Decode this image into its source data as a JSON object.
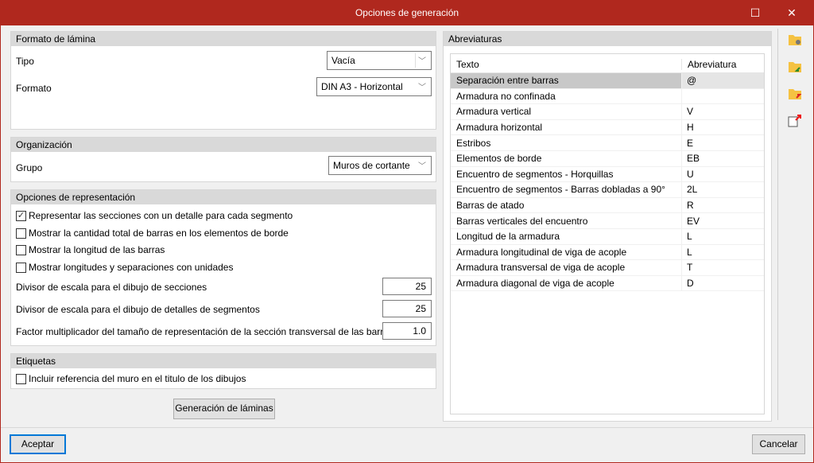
{
  "window": {
    "title": "Opciones de generación",
    "maximize_icon": "maximize-icon",
    "close_icon": "close-icon"
  },
  "formato": {
    "header": "Formato de lámina",
    "tipo_label": "Tipo",
    "tipo_value": "Vacía",
    "formato_label": "Formato",
    "formato_value": "DIN A3 - Horizontal"
  },
  "organizacion": {
    "header": "Organización",
    "grupo_label": "Grupo",
    "grupo_value": "Muros de cortante"
  },
  "representacion": {
    "header": "Opciones de representación",
    "checks": [
      {
        "label": "Representar las secciones con un detalle para cada segmento",
        "checked": true
      },
      {
        "label": "Mostrar la cantidad total de barras en los elementos de borde",
        "checked": false
      },
      {
        "label": "Mostrar la longitud de las barras",
        "checked": false
      },
      {
        "label": "Mostrar longitudes y separaciones con unidades",
        "checked": false
      }
    ],
    "fields": [
      {
        "label": "Divisor de escala para el dibujo de secciones",
        "value": "25"
      },
      {
        "label": "Divisor de escala para el dibujo de detalles de segmentos",
        "value": "25"
      },
      {
        "label": "Factor multiplicador del tamaño de representación de la sección transversal de las barras",
        "value": "1.0"
      }
    ]
  },
  "etiquetas": {
    "header": "Etiquetas",
    "check_label": "Incluir referencia del muro en el titulo de los dibujos",
    "checked": false
  },
  "generate_button": "Generación de láminas",
  "abreviaturas": {
    "header": "Abreviaturas",
    "col_texto": "Texto",
    "col_abrev": "Abreviatura",
    "rows": [
      {
        "texto": "Separación entre barras",
        "abrev": "@"
      },
      {
        "texto": "Armadura no confinada",
        "abrev": ""
      },
      {
        "texto": "Armadura vertical",
        "abrev": "V"
      },
      {
        "texto": "Armadura horizontal",
        "abrev": "H"
      },
      {
        "texto": "Estribos",
        "abrev": "E"
      },
      {
        "texto": "Elementos de borde",
        "abrev": "EB"
      },
      {
        "texto": "Encuentro de segmentos - Horquillas",
        "abrev": "U"
      },
      {
        "texto": "Encuentro de segmentos - Barras dobladas a 90°",
        "abrev": "2L"
      },
      {
        "texto": "Barras de atado",
        "abrev": "R"
      },
      {
        "texto": "Barras verticales del encuentro",
        "abrev": "EV"
      },
      {
        "texto": "Longitud de la armadura",
        "abrev": "L"
      },
      {
        "texto": "Armadura longitudinal de viga de acople",
        "abrev": "L"
      },
      {
        "texto": "Armadura transversal de viga de acople",
        "abrev": "T"
      },
      {
        "texto": "Armadura diagonal de viga de acople",
        "abrev": "D"
      }
    ]
  },
  "footer": {
    "accept": "Aceptar",
    "cancel": "Cancelar"
  },
  "colors": {
    "titlebar": "#b0281e",
    "accent": "#0078d7"
  }
}
